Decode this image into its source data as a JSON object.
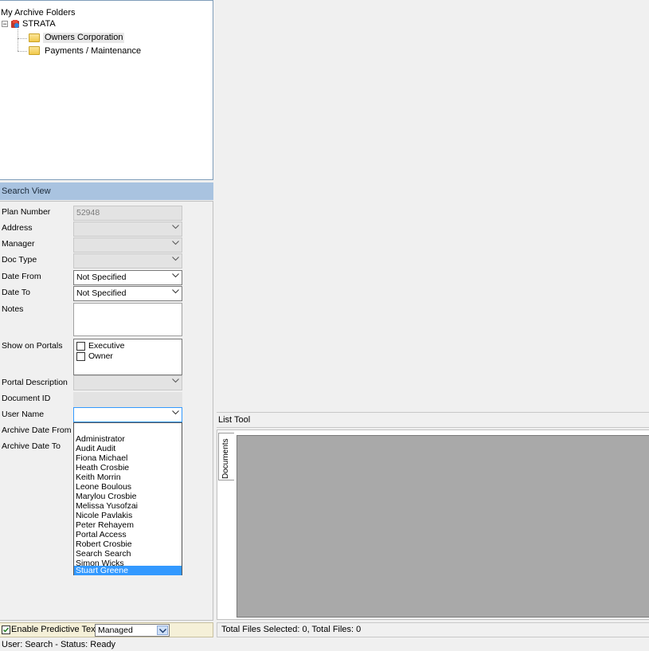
{
  "tree": {
    "root_label": "My Archive Folders",
    "node_label": "STRATA",
    "children": [
      "Owners Corporation",
      "Payments / Maintenance"
    ]
  },
  "search_view": {
    "title": "Search View",
    "fields": {
      "plan_number": {
        "label": "Plan Number",
        "value": "52948"
      },
      "address": {
        "label": "Address",
        "value": ""
      },
      "manager": {
        "label": "Manager",
        "value": ""
      },
      "doc_type": {
        "label": "Doc Type",
        "value": ""
      },
      "date_from": {
        "label": "Date From",
        "value": "Not Specified"
      },
      "date_to": {
        "label": "Date To",
        "value": "Not Specified"
      },
      "notes": {
        "label": "Notes",
        "value": ""
      },
      "show_on_portals": {
        "label": "Show on Portals",
        "options": [
          "Executive",
          "Owner"
        ]
      },
      "portal_description": {
        "label": "Portal Description",
        "value": ""
      },
      "document_id": {
        "label": "Document ID",
        "value": ""
      },
      "user_name": {
        "label": "User Name",
        "value": ""
      },
      "archive_date_from": {
        "label": "Archive Date From"
      },
      "archive_date_to": {
        "label": "Archive Date To"
      }
    },
    "user_options": [
      "Administrator",
      "Audit Audit",
      "Fiona Michael",
      "Heath Crosbie",
      "Keith Morrin",
      "Leone Boulous",
      "Marylou Crosbie",
      "Melissa  Yusofzai",
      "Nicole Pavlakis",
      "Peter Rehayem",
      "Portal Access",
      "Robert Crosbie",
      "Search Search",
      "Simon Wicks",
      "Stuart Greene"
    ],
    "selected_user": "Stuart Greene"
  },
  "predictive": {
    "label": "Enable Predictive Text",
    "value": "Managed",
    "checked": true
  },
  "list_tool": {
    "title": "List Tool",
    "tab_label": "Documents",
    "status": "Total Files Selected: 0, Total Files: 0"
  },
  "statusbar": {
    "text": "User: Search - Status: Ready"
  }
}
